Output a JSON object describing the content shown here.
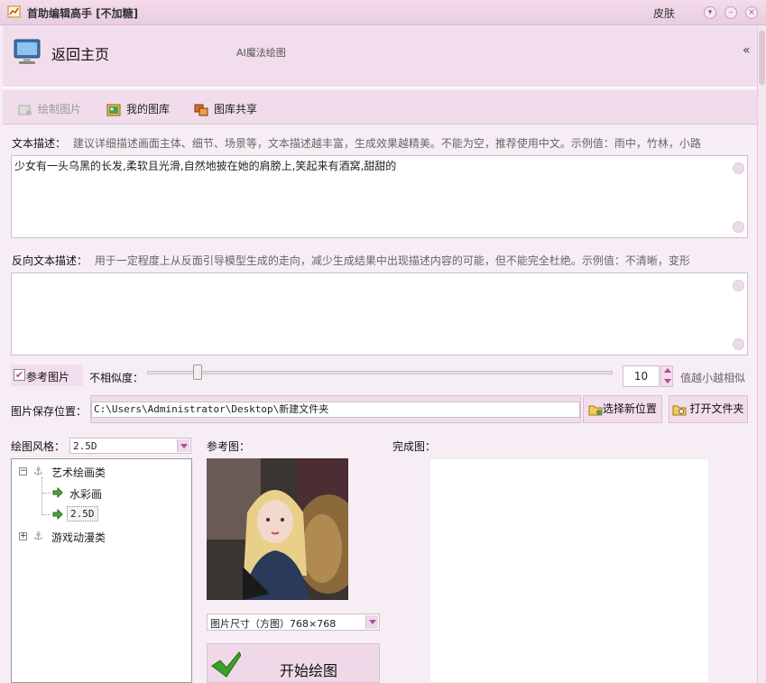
{
  "window": {
    "title": "首助编辑高手 [不加糖]",
    "skin_label": "皮肤"
  },
  "header": {
    "home_label": "返回主页",
    "center_title": "AI魔法绘图",
    "collapse_glyph": "«"
  },
  "toolbar": {
    "items": [
      {
        "label": "绘制图片",
        "icon": "draw-icon",
        "disabled": true
      },
      {
        "label": "我的图库",
        "icon": "gallery-icon",
        "disabled": false
      },
      {
        "label": "图库共享",
        "icon": "share-icon",
        "disabled": false
      }
    ]
  },
  "prompt": {
    "label": "文本描述：",
    "hint": "建议详细描述画面主体、细节、场景等，文本描述越丰富，生成效果越精美。不能为空，推荐使用中文。示例值：雨中，竹林，小路",
    "value": "少女有一头乌黑的长发,柔软且光滑,自然地披在她的肩膀上,笑起来有酒窝,甜甜的"
  },
  "negative_prompt": {
    "label": "反向文本描述：",
    "hint": "用于一定程度上从反面引导模型生成的走向，减少生成结果中出现描述内容的可能，但不能完全杜绝。示例值：不清晰，变形",
    "value": ""
  },
  "reference": {
    "checkbox_label": "参考图片",
    "checked": true,
    "dissimilarity_label": "不相似度：",
    "slider_value_fraction": 0.1,
    "spin_value": "10",
    "spin_hint": "值越小越相似"
  },
  "save": {
    "label": "图片保存位置：",
    "path": "C:\\Users\\Administrator\\Desktop\\新建文件夹",
    "choose_button": "选择新位置",
    "open_button": "打开文件夹"
  },
  "style": {
    "label": "绘图风格：",
    "selected": "2.5D",
    "tree": [
      {
        "label": "艺术绘画类",
        "expanded": true,
        "children": [
          "水彩画",
          "2.5D"
        ]
      },
      {
        "label": "游戏动漫类",
        "expanded": false,
        "children": []
      }
    ]
  },
  "ref_image_label": "参考图：",
  "result_label": "完成图：",
  "size": {
    "selected": "图片尺寸（方图）768×768"
  },
  "start_button": "开始绘图",
  "colors": {
    "accent": "#b04a96",
    "titlebar": "#ecd3e5",
    "panel": "#f2dded"
  }
}
